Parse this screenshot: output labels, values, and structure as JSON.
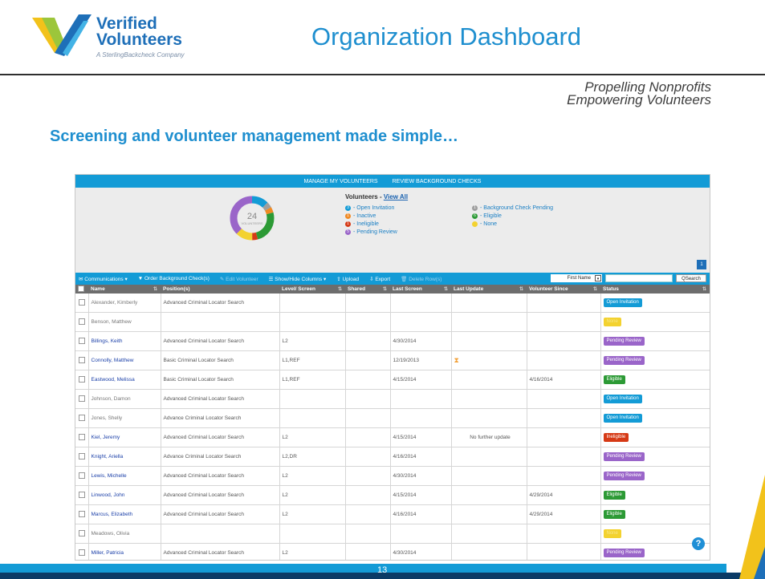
{
  "logo": {
    "line1": "Verified",
    "line2": "Volunteers",
    "sub": "A SterlingBackcheck Company"
  },
  "title": "Organization Dashboard",
  "tagline": {
    "line1": "Propelling Nonprofits",
    "line2": "Empowering Volunteers"
  },
  "subhead": "Screening and volunteer management made simple…",
  "app": {
    "topnav": [
      "MANAGE MY VOLUNTEERS",
      "REVIEW BACKGROUND CHECKS"
    ],
    "donut": {
      "count": "24",
      "label": "VOLUNTEERS"
    },
    "legend_title": "Volunteers - ",
    "view_all": "View All",
    "legend_left": [
      {
        "n": "3",
        "label": "- Open Invitation",
        "color": "#139bd6"
      },
      {
        "n": "1",
        "label": "- Inactive",
        "color": "#f08a24"
      },
      {
        "n": "1",
        "label": "- Ineligible",
        "color": "#d63a16"
      },
      {
        "n": "5",
        "label": "- Pending Review",
        "color": "#9a65c9"
      }
    ],
    "legend_right": [
      {
        "n": "1",
        "label": "- Background Check Pending",
        "color": "#9e9e9e"
      },
      {
        "n": "6",
        "label": "- Eligible",
        "color": "#2c9a35"
      },
      {
        "n": "",
        "label": "- None",
        "color": "#f3d230"
      }
    ],
    "page_badge": "1",
    "toolbar": {
      "communications": "✉ Communications ▾",
      "order": "▼ Order Background Check(s)",
      "edit": "✎ Edit Volunteer",
      "showhide": "☰ Show/Hide Columns ▾",
      "upload": "⇪ Upload",
      "export": "⇩ Export",
      "delete": "🗑 Delete Row(s)",
      "filter_field": "First Name",
      "search_button": "QSearch"
    },
    "columns": [
      "Name",
      "Position(s)",
      "Level/ Screen",
      "Shared",
      "Last Screen",
      "Last Update",
      "Volunteer Since",
      "Status"
    ],
    "rows": [
      {
        "name": "Alexander, Kimberly",
        "position": "Advanced Criminal Locator Search",
        "level": "",
        "shared": "",
        "last_screen": "",
        "last_update": "",
        "since": "",
        "status": "Open Invitation",
        "kind": "open",
        "grey": true
      },
      {
        "name": "Benson, Matthew",
        "position": "",
        "level": "",
        "shared": "",
        "last_screen": "",
        "last_update": "",
        "since": "",
        "status": "None",
        "kind": "none",
        "grey": true
      },
      {
        "name": "Billings, Keith",
        "position": "Advanced Criminal Locator Search",
        "level": "L2",
        "shared": "",
        "last_screen": "4/30/2014",
        "last_update": "",
        "since": "",
        "status": "Pending Review",
        "kind": "pend",
        "grey": false
      },
      {
        "name": "Connolly, Matthew",
        "position": "Basic Criminal Locator Search",
        "level": "L1,REF",
        "shared": "",
        "last_screen": "12/19/2013",
        "last_update": "⧗",
        "since": "",
        "status": "Pending Review",
        "kind": "pend",
        "grey": false
      },
      {
        "name": "Eastwood, Melissa",
        "position": "Basic Criminal Locator Search",
        "level": "L1,REF",
        "shared": "",
        "last_screen": "4/15/2014",
        "last_update": "",
        "since": "4/16/2014",
        "status": "Eligible",
        "kind": "elig",
        "grey": false
      },
      {
        "name": "Johnson, Damon",
        "position": "Advanced Criminal Locator Search",
        "level": "",
        "shared": "",
        "last_screen": "",
        "last_update": "",
        "since": "",
        "status": "Open Invitation",
        "kind": "open",
        "grey": true
      },
      {
        "name": "Jones, Shelly",
        "position": "Advance Criminal Locator Search",
        "level": "",
        "shared": "",
        "last_screen": "",
        "last_update": "",
        "since": "",
        "status": "Open Invitation",
        "kind": "open",
        "grey": true
      },
      {
        "name": "Kiel, Jeremy",
        "position": "Advanced Criminal Locator Search",
        "level": "L2",
        "shared": "",
        "last_screen": "4/15/2014",
        "last_update": "No further update",
        "since": "",
        "status": "Ineligible",
        "kind": "inel",
        "grey": false
      },
      {
        "name": "Knight, Ariella",
        "position": "Advance Criminal Locator Search",
        "level": "L2,DR",
        "shared": "",
        "last_screen": "4/16/2014",
        "last_update": "",
        "since": "",
        "status": "Pending Review",
        "kind": "pend",
        "grey": false
      },
      {
        "name": "Lewis, Michelle",
        "position": "Advanced Criminal Locator Search",
        "level": "L2",
        "shared": "",
        "last_screen": "4/30/2014",
        "last_update": "",
        "since": "",
        "status": "Pending Review",
        "kind": "pend",
        "grey": false
      },
      {
        "name": "Linwood, John",
        "position": "Advanced Criminal Locator Search",
        "level": "L2",
        "shared": "",
        "last_screen": "4/15/2014",
        "last_update": "",
        "since": "4/29/2014",
        "status": "Eligible",
        "kind": "elig",
        "grey": false
      },
      {
        "name": "Marcus, Elizabeth",
        "position": "Advanced Criminal Locator Search",
        "level": "L2",
        "shared": "",
        "last_screen": "4/16/2014",
        "last_update": "",
        "since": "4/29/2014",
        "status": "Eligible",
        "kind": "elig",
        "grey": false
      },
      {
        "name": "Meadows, Olivia",
        "position": "",
        "level": "",
        "shared": "",
        "last_screen": "",
        "last_update": "",
        "since": "",
        "status": "None",
        "kind": "none",
        "grey": true
      },
      {
        "name": "Miller, Patricia",
        "position": "Advanced Criminal Locator Search",
        "level": "L2",
        "shared": "",
        "last_screen": "4/30/2014",
        "last_update": "",
        "since": "",
        "status": "Pending Review",
        "kind": "pend",
        "grey": false
      }
    ],
    "help_icon": "?"
  },
  "page_number": "13",
  "colors": {
    "accent": "#139bd6",
    "title": "#1f8fcf",
    "navy": "#0b3b66",
    "yellow": "#f3d230"
  }
}
